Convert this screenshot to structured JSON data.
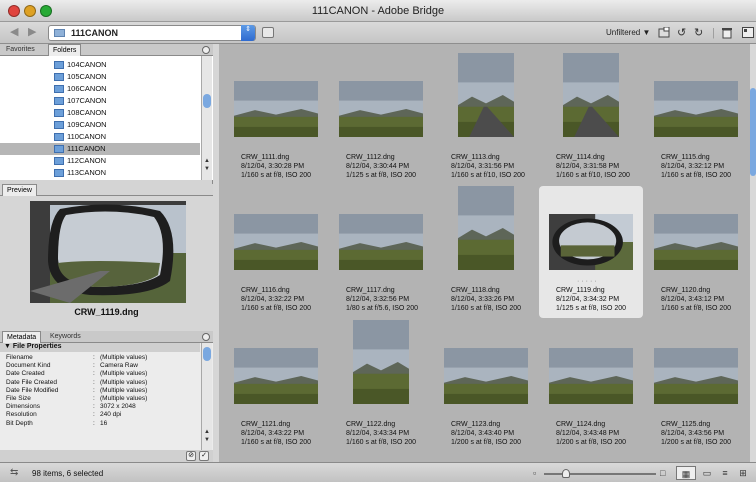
{
  "window": {
    "title": "111CANON - Adobe Bridge"
  },
  "toolbar": {
    "path": "111CANON",
    "filter": "Unfiltered",
    "filter_arrow": "▼",
    "back": "◀",
    "forward": "▶",
    "path_arrows": "⇕"
  },
  "panels": {
    "tab_favorites": "Favorites",
    "tab_folders": "Folders",
    "folders": [
      "104CANON",
      "105CANON",
      "106CANON",
      "107CANON",
      "108CANON",
      "109CANON",
      "110CANON",
      "111CANON",
      "112CANON",
      "113CANON"
    ],
    "selected_folder": "111CANON",
    "tab_preview": "Preview",
    "preview_caption": "CRW_1119.dng",
    "tab_metadata": "Metadata",
    "tab_keywords": "Keywords",
    "meta_section": "▼ File Properties",
    "metadata": [
      {
        "k": "Filename",
        "v": "(Multiple values)"
      },
      {
        "k": "Document Kind",
        "v": "Camera Raw"
      },
      {
        "k": "Date Created",
        "v": "(Multiple values)"
      },
      {
        "k": "Date File Created",
        "v": "(Multiple values)"
      },
      {
        "k": "Date File Modified",
        "v": "(Multiple values)"
      },
      {
        "k": "File Size",
        "v": "(Multiple values)"
      },
      {
        "k": "Dimensions",
        "v": "3072 x 2048"
      },
      {
        "k": "Resolution",
        "v": "240 dpi"
      },
      {
        "k": "Bit Depth",
        "v": "16"
      }
    ]
  },
  "thumbnails": [
    {
      "name": "CRW_1111.dng",
      "date": "8/12/04, 3:30:28 PM",
      "exp": "1/160 s at f/8, ISO 200",
      "orient": "landscape",
      "scene": "moor"
    },
    {
      "name": "CRW_1112.dng",
      "date": "8/12/04, 3:30:44 PM",
      "exp": "1/125 s at f/8, ISO 200",
      "orient": "landscape",
      "scene": "moor"
    },
    {
      "name": "CRW_1113.dng",
      "date": "8/12/04, 3:31:56 PM",
      "exp": "1/160 s at f/10, ISO 200",
      "orient": "portrait",
      "scene": "road"
    },
    {
      "name": "CRW_1114.dng",
      "date": "8/12/04, 3:31:58 PM",
      "exp": "1/160 s at f/10, ISO 200",
      "orient": "portrait",
      "scene": "road"
    },
    {
      "name": "CRW_1115.dng",
      "date": "8/12/04, 3:32:12 PM",
      "exp": "1/160 s at f/8, ISO 200",
      "orient": "landscape",
      "scene": "moor"
    },
    {
      "name": "CRW_1116.dng",
      "date": "8/12/04, 3:32:22 PM",
      "exp": "1/160 s at f/8, ISO 200",
      "orient": "landscape",
      "scene": "moor"
    },
    {
      "name": "CRW_1117.dng",
      "date": "8/12/04, 3:32:56 PM",
      "exp": "1/80 s at f/5.6, ISO 200",
      "orient": "landscape",
      "scene": "moor"
    },
    {
      "name": "CRW_1118.dng",
      "date": "8/12/04, 3:33:26 PM",
      "exp": "1/160 s at f/8, ISO 200",
      "orient": "portrait",
      "scene": "moor"
    },
    {
      "name": "CRW_1119.dng",
      "date": "8/12/04, 3:34:32 PM",
      "exp": "1/125 s at f/8, ISO 200",
      "orient": "landscape",
      "scene": "mirror",
      "selected": true
    },
    {
      "name": "CRW_1120.dng",
      "date": "8/12/04, 3:43:12 PM",
      "exp": "1/160 s at f/8, ISO 200",
      "orient": "landscape",
      "scene": "moor"
    },
    {
      "name": "CRW_1121.dng",
      "date": "8/12/04, 3:43:22 PM",
      "exp": "1/160 s at f/8, ISO 200",
      "orient": "landscape",
      "scene": "moor"
    },
    {
      "name": "CRW_1122.dng",
      "date": "8/12/04, 3:43:34 PM",
      "exp": "1/160 s at f/8, ISO 200",
      "orient": "portrait",
      "scene": "moor"
    },
    {
      "name": "CRW_1123.dng",
      "date": "8/12/04, 3:43:40 PM",
      "exp": "1/200 s at f/8, ISO 200",
      "orient": "landscape",
      "scene": "moor"
    },
    {
      "name": "CRW_1124.dng",
      "date": "8/12/04, 3:43:48 PM",
      "exp": "1/200 s at f/8, ISO 200",
      "orient": "landscape",
      "scene": "moor"
    },
    {
      "name": "CRW_1125.dng",
      "date": "8/12/04, 3:43:56 PM",
      "exp": "1/200 s at f/8, ISO 200",
      "orient": "landscape",
      "scene": "moor"
    }
  ],
  "status": {
    "text": "98 items, 6 selected",
    "zoom_position": 0.2
  },
  "colors": {
    "accent": "#3a76d8",
    "selection": "#b6b6b6",
    "content_bg": "#b3b3b3"
  }
}
